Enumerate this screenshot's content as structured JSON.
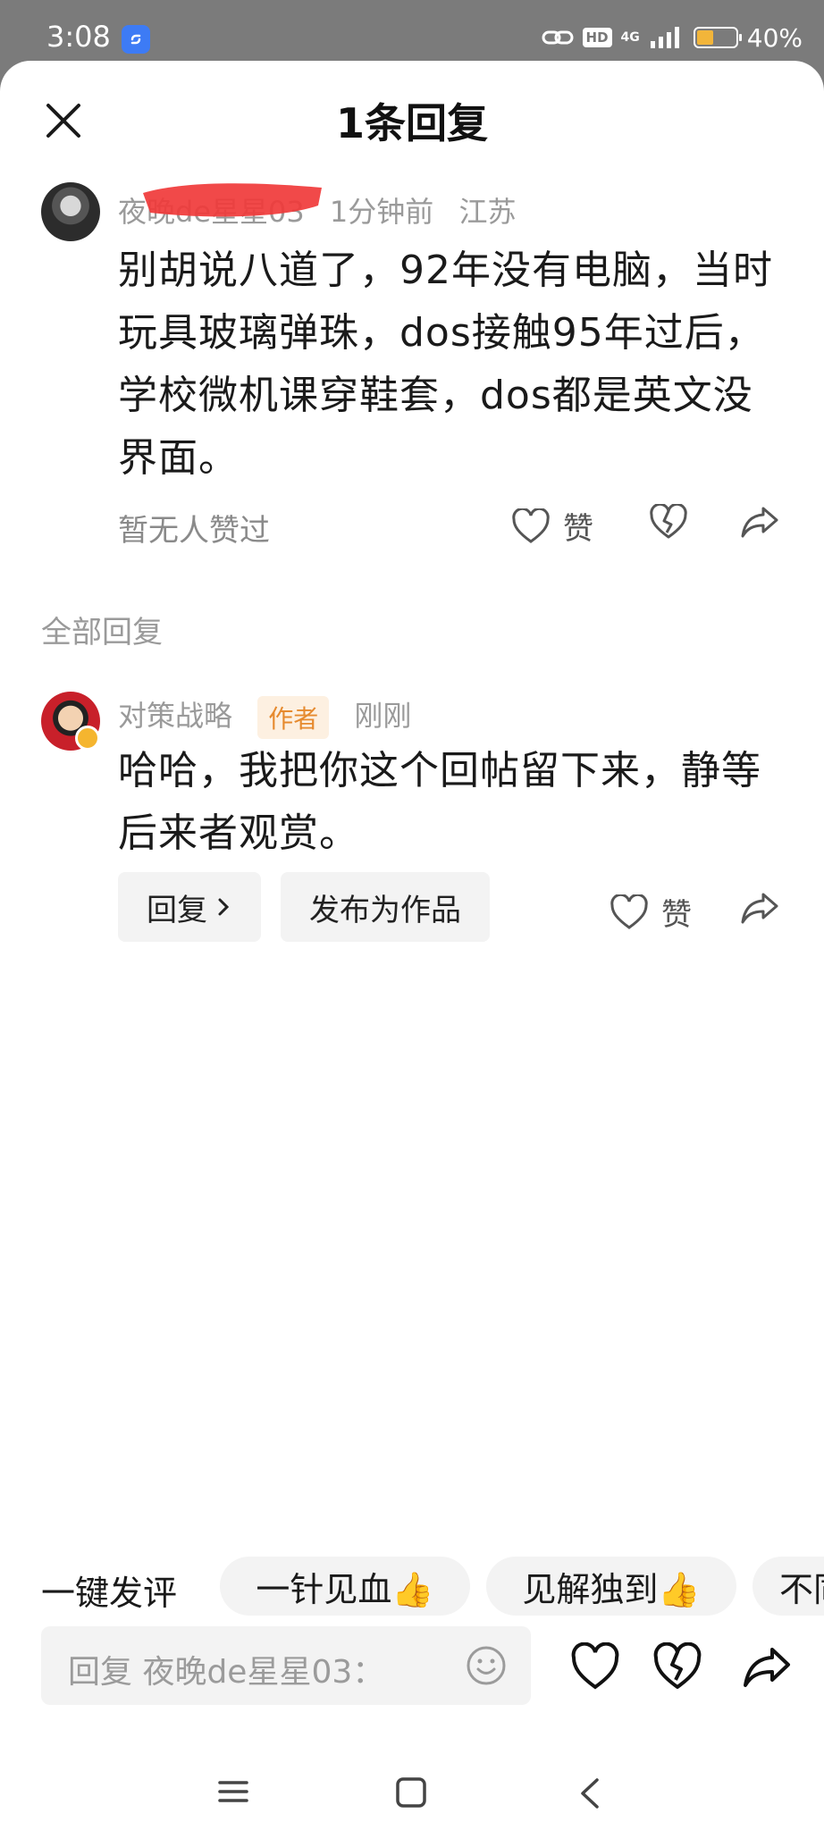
{
  "status_bar": {
    "time": "3:08",
    "network": "4G",
    "hd": "HD",
    "battery": "40%",
    "battery_level": 0.4
  },
  "header": {
    "title": "1条回复"
  },
  "main_comment": {
    "username": "夜晚de星星03",
    "time": "1分钟前",
    "location": "江苏",
    "text": "别胡说八道了，92年没有电脑，当时玩具玻璃弹珠，dos接触95年过后，学校微机课穿鞋套，dos都是英文没界面。",
    "likes_text": "暂无人赞过",
    "like_label": "赞"
  },
  "section": {
    "all_replies": "全部回复"
  },
  "reply": {
    "username": "对策战略",
    "tag": "作者",
    "time": "刚刚",
    "text": "哈哈，我把你这个回帖留下来，静等后来者观赏。",
    "reply_button": "回复",
    "publish_button": "发布为作品",
    "like_label": "赞"
  },
  "quick_comments": {
    "title": "一键发评",
    "chips": [
      "一针见血👍",
      "见解独到👍",
      "不同"
    ]
  },
  "input": {
    "placeholder": "回复 夜晚de星星03："
  },
  "colors": {
    "author_tag_bg": "#fdf0e1",
    "author_tag_fg": "#e68a2e",
    "accent_blue": "#3d7bf5",
    "battery_fill": "#f2b53a"
  }
}
